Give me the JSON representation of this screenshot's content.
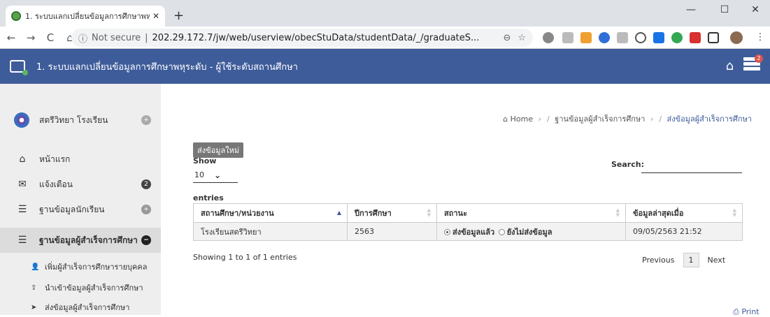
{
  "browser": {
    "tab_title": "1. ระบบแลกเปลี่ยนข้อมูลการศึกษาพหุร",
    "url_security": "Not secure",
    "url": "202.29.172.7/jw/web/userview/obecStuData/studentData/_/graduateS..."
  },
  "header": {
    "title": "1. ระบบแลกเปลี่ยนข้อมูลการศึกษาพหุระดับ - ผู้ใช้ระดับสถานศึกษา",
    "notification_count": "2"
  },
  "sidebar": {
    "user_name": "สตรีวิทยา โรงเรียน",
    "items": [
      {
        "label": "หน้าแรก"
      },
      {
        "label": "แจ้งเตือน",
        "badge": "2"
      },
      {
        "label": "ฐานข้อมูลนักเรียน"
      },
      {
        "label": "ฐานข้อมูลผู้สำเร็จการศึกษา"
      }
    ],
    "subitems": [
      {
        "label": "เพิ่มผู้สำเร็จการศึกษารายบุคคล"
      },
      {
        "label": "นำเข้าข้อมูลผู้สำเร็จการศึกษา"
      },
      {
        "label": "ส่งข้อมูลผู้สำเร็จการศึกษา"
      }
    ]
  },
  "breadcrumb": {
    "home": "Home",
    "level1": "ฐานข้อมูลผู้สำเร็จการศึกษา",
    "current": "ส่งข้อมูลผู้สำเร็จการศึกษา"
  },
  "main": {
    "send_new_label": "ส่งข้อมูลใหม่",
    "show_label": "Show",
    "show_value": "10",
    "entries_label": "entries",
    "search_label": "Search:",
    "search_value": "",
    "columns": [
      "สถานศึกษา/หน่วยงาน",
      "ปีการศึกษา",
      "สถานะ",
      "ข้อมูลล่าสุดเมื่อ"
    ],
    "rows": [
      {
        "school": "โรงเรียนสตรีวิทยา",
        "year": "2563",
        "status_sent": "ส่งข้อมูลแล้ว",
        "status_unsent": "ยังไม่ส่งข้อมูล",
        "updated": "09/05/2563 21:52"
      }
    ],
    "info": "Showing 1 to 1 of 1 entries",
    "prev": "Previous",
    "page": "1",
    "next": "Next",
    "print": "Print"
  },
  "colors": {
    "header_bg": "#3e5c9a",
    "sidebar_bg": "#eeeeee"
  }
}
